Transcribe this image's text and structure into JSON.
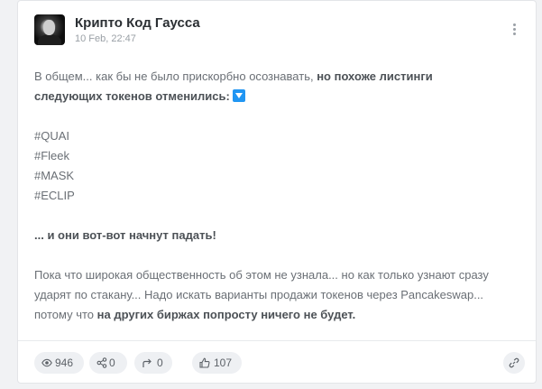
{
  "post": {
    "author": "Крипто Код Гаусса",
    "date": "10 Feb, 22:47",
    "p1_normal": "В общем... как бы не было прискорбно осознавать, ",
    "p1_bold": "но похоже листинги следующих токенов отменились:",
    "p1_emoji": "blue-down-arrow-emoji",
    "tags": [
      "#QUAI",
      "#Fleek",
      "#MASK",
      "#ECLIP"
    ],
    "p2_bold": "... и они вот-вот начнут падать!",
    "p3_normal": "Пока что широкая общественность об этом не узнала... но как только узнают сразу ударят по стакану... Надо искать варианты продажи токенов через Pancakeswap... потому что ",
    "p3_bold": "на других биржах попросту ничего не будет."
  },
  "stats": {
    "views": "946",
    "shares": "0",
    "reposts": "0",
    "likes": "107"
  },
  "icons": {
    "views": "eye-icon",
    "shares": "share-icon",
    "reposts": "repost-icon",
    "likes": "thumbs-up-icon",
    "link": "link-icon",
    "menu": "kebab-menu-icon"
  },
  "colors": {
    "background": "#f1f2f4",
    "card": "#ffffff",
    "emoji": "#2196f3"
  }
}
